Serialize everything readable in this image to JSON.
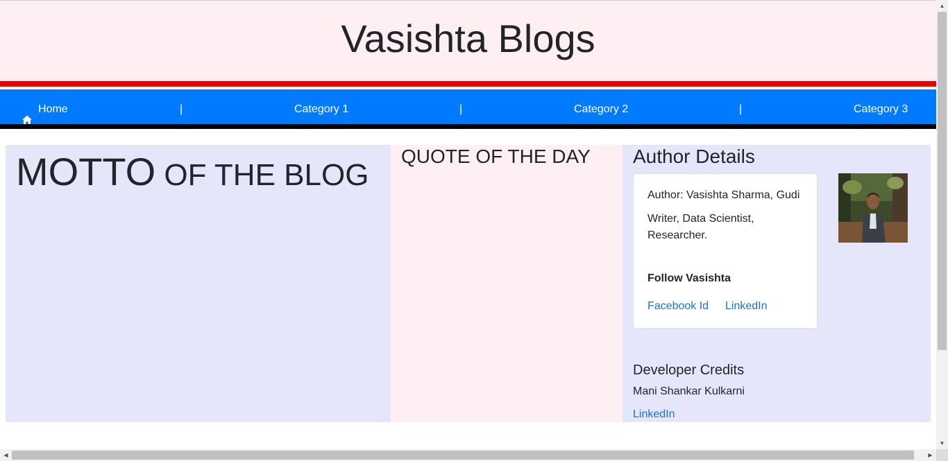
{
  "header": {
    "title": "Vasishta Blogs"
  },
  "nav": {
    "home_label": "Home",
    "separator": "|",
    "category1": "Category 1",
    "category2": "Category 2",
    "category3": "Category 3"
  },
  "motto": {
    "big": "MOTTO",
    "rest": " OF THE BLOG"
  },
  "quote": {
    "title": "QUOTE OF THE DAY"
  },
  "author": {
    "title": "Author Details",
    "line1": "Author: Vasishta Sharma, Gudi",
    "line2": "Writer, Data Scientist, Researcher.",
    "follow": "Follow Vasishta",
    "facebook": "Facebook Id",
    "linkedin": "LinkedIn"
  },
  "developer": {
    "title": "Developer Credits",
    "name": "Mani Shankar Kulkarni",
    "linkedin": "LinkedIn"
  },
  "colors": {
    "header_bg": "#ffeef2",
    "nav_bg": "#007bff",
    "red_stripe": "#ee0000",
    "lavender": "#e6e6fa",
    "link": "#1a73d9"
  }
}
